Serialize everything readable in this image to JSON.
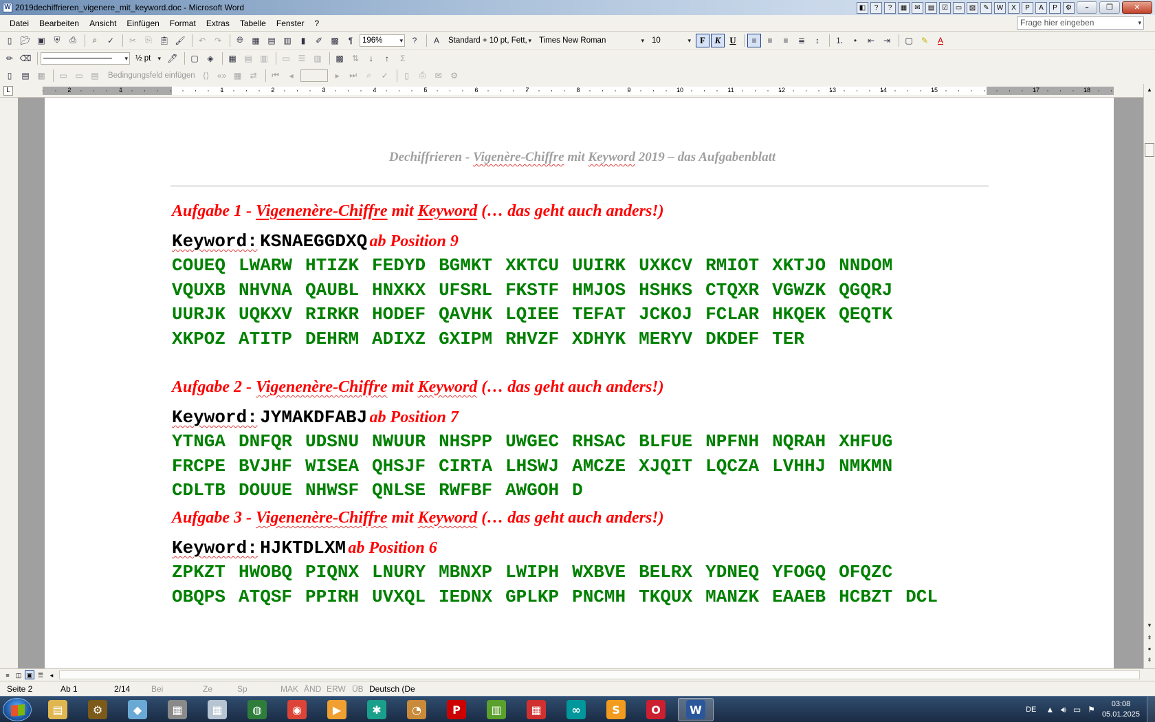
{
  "window": {
    "title": "2019dechiffrieren_vigenere_mit_keyword.doc - Microsoft Word",
    "app_icon": "W"
  },
  "menu": {
    "items": [
      "Datei",
      "Bearbeiten",
      "Ansicht",
      "Einfügen",
      "Format",
      "Extras",
      "Tabelle",
      "Fenster",
      "?"
    ],
    "help_placeholder": "Frage hier eingeben"
  },
  "toolbar_standard": {
    "zoom": "196%",
    "style": "Standard + 10 pt, Fett,",
    "font": "Times New Roman",
    "font_size": "10",
    "bold": "F",
    "italic": "K",
    "underline": "U"
  },
  "toolbar_drawing": {
    "line_weight": "½ pt"
  },
  "toolbar_forms": {
    "conditional_field": "Bedingungsfeld einfügen"
  },
  "ruler": {
    "labels": [
      "2",
      "1",
      "1",
      "2",
      "3",
      "4",
      "5",
      "6",
      "7",
      "8",
      "9",
      "10",
      "11",
      "12",
      "13",
      "14",
      "15",
      "17",
      "18"
    ]
  },
  "document": {
    "header": {
      "prefix": "Dechiffrieren - ",
      "title_a": "Vigenère-Chiffre",
      "middle": " mit ",
      "title_b": "Keyword",
      "suffix": " 2019 – das Aufgabenblatt"
    },
    "tasks": [
      {
        "heading_prefix": "Aufgabe 1 - ",
        "heading_a": "Vigenenère-Chiffre",
        "heading_mid": " mit ",
        "heading_b": "Keyword",
        "heading_suffix": " (… das geht auch anders!)",
        "keyword_label": "Keyword:",
        "keyword_value": "KSNAEGGDXQ",
        "position": "ab Position 9",
        "cipher": [
          "COUEQ",
          "LWARW",
          "HTIZK",
          "FEDYD",
          "BGMKT",
          "XKTCU",
          "UUIRK",
          "UXKCV",
          "RMIOT",
          "XKTJO",
          "NNDOM",
          "VQUXB",
          "NHVNA",
          "QAUBL",
          "HNXKX",
          "UFSRL",
          "FKSTF",
          "HMJOS",
          "HSHKS",
          "CTQXR",
          "VGWZK",
          "QGQRJ",
          "UURJK",
          "UQKXV",
          "RIRKR",
          "HODEF",
          "QAVHK",
          "LQIEE",
          "TEFAT",
          "JCKOJ",
          "FCLAR",
          "HKQEK",
          "QEQTK",
          "XKPOZ",
          "ATITP",
          "DEHRM",
          "ADIXZ",
          "GXIPM",
          "RHVZF",
          "XDHYK",
          "MERYV",
          "DKDEF",
          "TER"
        ]
      },
      {
        "heading_prefix": "Aufgabe 2 - ",
        "heading_a": "Vigenenère-Chiffre",
        "heading_mid": " mit ",
        "heading_b": "Keyword",
        "heading_suffix": " (… das geht auch anders!)",
        "keyword_label": "Keyword:",
        "keyword_value": "JYMAKDFABJ",
        "position": "ab Position 7",
        "cipher": [
          "YTNGA",
          "DNFQR",
          "UDSNU",
          "NWUUR",
          "NHSPP",
          "UWGEC",
          "RHSAC",
          "BLFUE",
          "NPFNH",
          "NQRAH",
          "XHFUG",
          "FRCPE",
          "BVJHF",
          "WISEA",
          "QHSJF",
          "CIRTA",
          "LHSWJ",
          "AMCZE",
          "XJQIT",
          "LQCZA",
          "LVHHJ",
          "NMKMN",
          "CDLTB",
          "DOUUE",
          "NHWSF",
          "QNLSE",
          "RWFBF",
          "AWGOH",
          "D"
        ]
      },
      {
        "heading_prefix": "Aufgabe 3 - ",
        "heading_a": "Vigenenère-Chiffre",
        "heading_mid": " mit ",
        "heading_b": "Keyword",
        "heading_suffix": " (… das geht auch anders!)",
        "keyword_label": "Keyword:",
        "keyword_value": "HJKTDLXM",
        "position": "ab Position 6",
        "cipher": [
          "ZPKZT",
          "HWOBQ",
          "PIQNX",
          "LNURY",
          "MBNXP",
          "LWIPH",
          "WXBVE",
          "BELRX",
          "YDNEQ",
          "YFOGQ",
          "OFQZC",
          "OBQPS",
          "ATQSF",
          "PPIRH",
          "UVXQL",
          "IEDNX",
          "GPLKP",
          "PNCMH",
          "TKQUX",
          "MANZK",
          "EAAEB",
          "HCBZT",
          "DCL"
        ]
      }
    ]
  },
  "status": {
    "page": "Seite 2",
    "section": "Ab 1",
    "pages": "2/14",
    "at": "Bei",
    "line": "Ze",
    "col": "Sp",
    "rec": "MAK",
    "trk": "ÄND",
    "ext": "ERW",
    "ovr": "ÜB",
    "language": "Deutsch (De"
  },
  "taskbar": {
    "apps": [
      "explorer-icon",
      "gear-app-icon",
      "notes-icon",
      "archive-icon",
      "calculator-icon",
      "globe-icon",
      "chrome-icon",
      "media-player-icon",
      "puzzle-app-icon",
      "paint-icon",
      "red-p-app-icon",
      "spreadsheet-icon",
      "mondrian-app-icon",
      "arduino-icon",
      "sublime-icon",
      "opera-icon",
      "word-icon"
    ],
    "lang": "DE",
    "time": "03:08",
    "date": "05.01.2025"
  },
  "colors": {
    "heading_red": "#ff0000",
    "cipher_green": "#008000",
    "header_gray": "#a0a0a0"
  }
}
